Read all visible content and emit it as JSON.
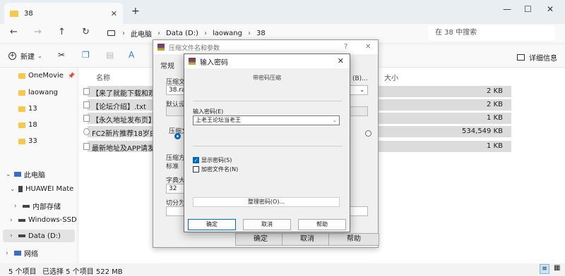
{
  "tab": {
    "title": "38",
    "close": "✕",
    "newtab": "+"
  },
  "window": {
    "minimize": "—",
    "maximize": "☐",
    "close": "✕"
  },
  "nav": {
    "back": "←",
    "forward": "→",
    "up": "↑",
    "refresh": "↻",
    "breadcrumbs": [
      "此电脑",
      "Data (D:)",
      "laowang",
      "38"
    ],
    "search_placeholder": "在 38 中搜索"
  },
  "toolbar": {
    "new_label": "新建",
    "details_label": "详细信息"
  },
  "sidebar": {
    "quick": [
      {
        "label": "OneMovie",
        "pinned": true
      },
      {
        "label": "laowang"
      },
      {
        "label": "13"
      },
      {
        "label": "18"
      },
      {
        "label": "33"
      }
    ],
    "this_pc": "此电脑",
    "huawei": "HUAWEI Mate",
    "internal": "内部存储",
    "windows": "Windows-SSD",
    "data_drive": "Data (D:)",
    "network": "网络"
  },
  "main": {
    "col_name": "名称",
    "col_size": "大小",
    "rows": [
      {
        "name": "【来了就能下载和观",
        "size": "2 KB"
      },
      {
        "name": "【论坛介绍】.txt",
        "size": "2 KB"
      },
      {
        "name": "【永久地址发布页】",
        "size": "1 KB"
      },
      {
        "name": "FC2新片推荐18岁白",
        "size": "534,549 KB"
      },
      {
        "name": "最新地址及APP请发",
        "size": "1 KB"
      }
    ]
  },
  "status": {
    "count": "5 个项目",
    "selected": "已选择 5 个项目  522 MB"
  },
  "archive_dialog": {
    "title": "压缩文件名和参数",
    "help": "?",
    "close": "✕",
    "tab_general": "常规",
    "archive_name_label": "压缩文件",
    "archive_name": "38.rar",
    "browse": "(B)...",
    "default_profile": "默认设",
    "format_label": "压缩文",
    "method_label": "压缩方",
    "method_value": "标准",
    "dict_label": "字典大",
    "dict_value": "32",
    "split_label": "切分为",
    "ok": "确定",
    "cancel": "取消",
    "help_btn": "帮助"
  },
  "password_dialog": {
    "title": "输入密码",
    "close": "✕",
    "subtitle": "带密码压缩",
    "password_label": "输入密码(E)",
    "password_value": "上老王论坛当老王",
    "show_password": "显示密码(S)",
    "encrypt_names": "加密文件名(N)",
    "manage": "整理密码(O)...",
    "ok": "确定",
    "cancel": "取消",
    "help": "帮助"
  }
}
